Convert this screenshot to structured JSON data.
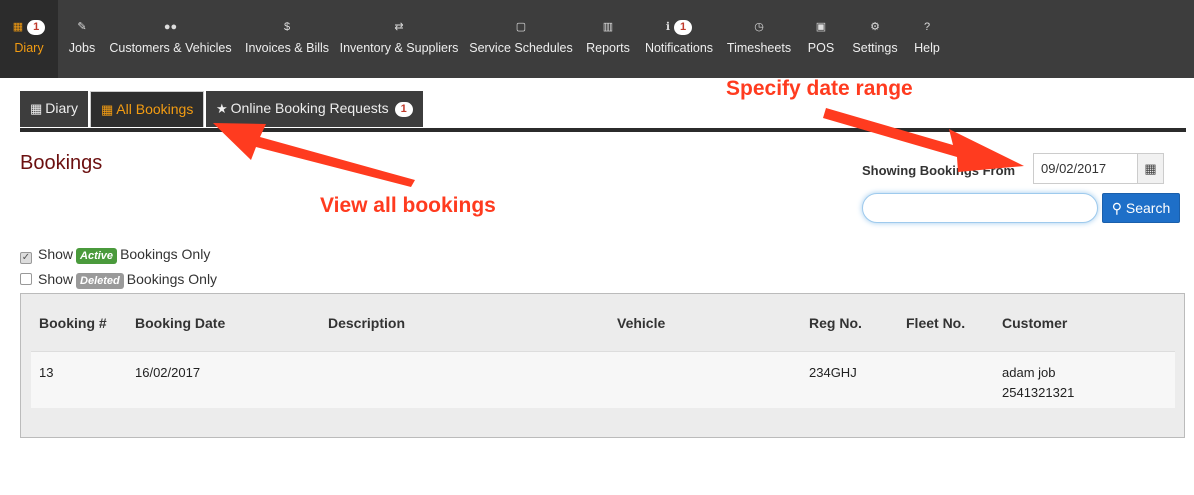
{
  "nav": {
    "items": [
      {
        "label": "Diary",
        "icon": "calendar-icon",
        "glyph": "▦",
        "badge": "1"
      },
      {
        "label": "Jobs",
        "icon": "wrench-icon",
        "glyph": "✎"
      },
      {
        "label": "Customers & Vehicles",
        "icon": "users-icon",
        "glyph": "👥"
      },
      {
        "label": "Invoices & Bills",
        "icon": "dollar-icon",
        "glyph": "$"
      },
      {
        "label": "Inventory & Suppliers",
        "icon": "retweet-icon",
        "glyph": "⇄"
      },
      {
        "label": "Service Schedules",
        "icon": "calendar-o-icon",
        "glyph": "▢"
      },
      {
        "label": "Reports",
        "icon": "bar-chart-icon",
        "glyph": "▥"
      },
      {
        "label": "Notifications",
        "icon": "info-circle-icon",
        "glyph": "ℹ",
        "badge": "1"
      },
      {
        "label": "Timesheets",
        "icon": "clock-icon",
        "glyph": "◷"
      },
      {
        "label": "POS",
        "icon": "money-icon",
        "glyph": "▣"
      },
      {
        "label": "Settings",
        "icon": "cogs-icon",
        "glyph": "⚙"
      },
      {
        "label": "Help",
        "icon": "question-icon",
        "glyph": "?"
      }
    ]
  },
  "tabs": {
    "diary": {
      "label": "Diary",
      "icon": "calendar-icon"
    },
    "all_bookings": {
      "label": "All Bookings",
      "icon": "calendar-icon"
    },
    "online_requests": {
      "label": "Online Booking Requests",
      "icon": "star-icon",
      "badge": "1"
    }
  },
  "page": {
    "title": "Bookings"
  },
  "date_filter": {
    "label": "Showing Bookings From",
    "value": "09/02/2017"
  },
  "search": {
    "value": "",
    "button_label": "Search"
  },
  "filters": [
    {
      "prefix": "Show",
      "pill": "Active",
      "suffix": "Bookings Only",
      "checked": true
    },
    {
      "prefix": "Show",
      "pill": "Deleted",
      "suffix": "Bookings Only",
      "checked": false
    }
  ],
  "table": {
    "headers": [
      "Booking #",
      "Booking Date",
      "Description",
      "Vehicle",
      "Reg No.",
      "Fleet No.",
      "Customer"
    ],
    "rows": [
      {
        "booking_no": "13",
        "date": "16/02/2017",
        "description": "",
        "vehicle": "",
        "reg_no": "234GHJ",
        "fleet_no": "",
        "customer_name": "adam job",
        "customer_phone": "2541321321"
      }
    ]
  },
  "annotations": {
    "date_range": "Specify date range",
    "view_all": "View all bookings"
  },
  "colors": {
    "nav_bg": "#3d3d3d",
    "accent": "#f39c12",
    "title": "#6b0f0f",
    "primary": "#1e6fc8",
    "annotation": "#ff3b1f",
    "active_pill": "#4a9a3c",
    "deleted_pill": "#9a9a9a"
  }
}
